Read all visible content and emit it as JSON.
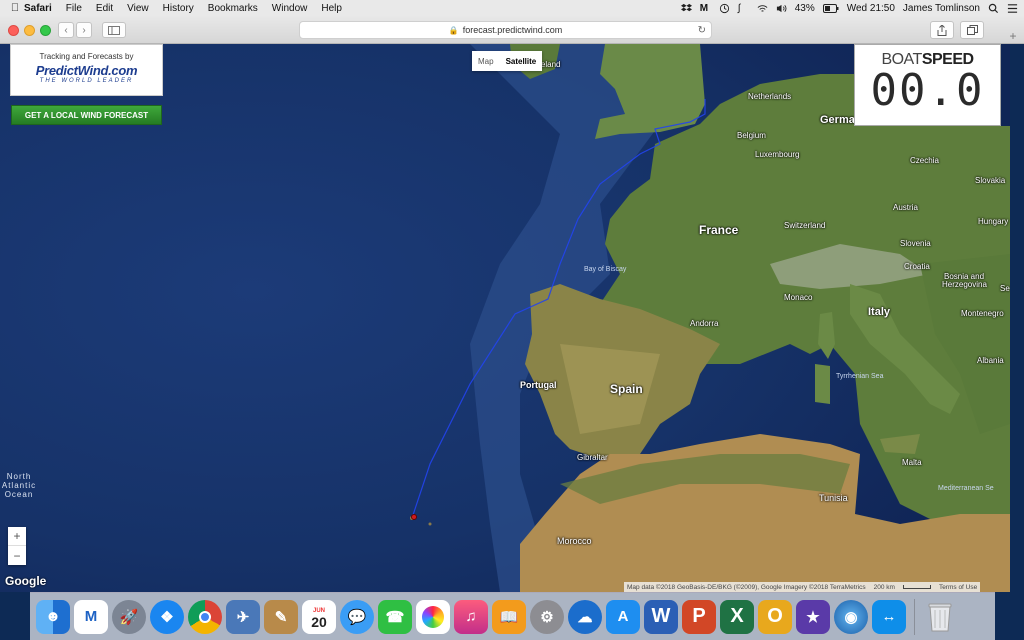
{
  "menubar": {
    "app": "Safari",
    "items": [
      "File",
      "Edit",
      "View",
      "History",
      "Bookmarks",
      "Window",
      "Help"
    ],
    "battery": "43%",
    "clock": "Wed 21:50",
    "user": "James Tomlinson"
  },
  "browser": {
    "url": "forecast.predictwind.com"
  },
  "page": {
    "logo_tagline": "Tracking and Forecasts by",
    "logo_brand": "PredictWind.com",
    "logo_slogan": "THE WORLD LEADER",
    "forecast_button": "GET A LOCAL WIND FORECAST",
    "maptype_map": "Map",
    "maptype_satellite": "Satellite",
    "boatspeed_prefix": "BOAT",
    "boatspeed_suffix": "SPEED",
    "boatspeed_value": "00.0",
    "zoom_in": "+",
    "zoom_out": "−",
    "google": "Google",
    "attribution": "Map data ©2018 GeoBasis-DE/BKG (©2009), Google Imagery ©2018 TerraMetrics",
    "scale": "200 km",
    "terms": "Terms of Use"
  },
  "map_labels": {
    "ireland": "Ireland",
    "netherlands": "Netherlands",
    "belgium": "Belgium",
    "luxembourg": "Luxembourg",
    "germany": "Germa",
    "czechia": "Czechia",
    "slovakia": "Slovakia",
    "austria": "Austria",
    "hungary": "Hungary",
    "france": "France",
    "switzerland": "Switzerland",
    "slovenia": "Slovenia",
    "croatia": "Croatia",
    "bosnia": "Bosnia and",
    "herzegovina": "Herzegovina",
    "serbia": "Se",
    "bay_biscay": "Bay of Biscay",
    "monaco": "Monaco",
    "andorra": "Andorra",
    "italy": "Italy",
    "montenegro": "Montenegro",
    "portugal": "Portugal",
    "spain": "Spain",
    "tyrrhenian": "Tyrrhenian Sea",
    "albania": "Albania",
    "gibraltar": "Gibraltar",
    "malta": "Malta",
    "mediterranean": "Mediterranean Se",
    "tunisia": "Tunisia",
    "morocco": "Morocco",
    "ocean_line1": "North",
    "ocean_line2": "Atlantic",
    "ocean_line3": "Ocean"
  },
  "dock": {
    "word": "W",
    "powerpoint": "P",
    "excel": "X",
    "outlook": "O",
    "calendar_month": "JUN",
    "calendar_day": "20"
  },
  "colors": {
    "ocean": "#1f3f80",
    "land": "#5d7a3a",
    "track": "#2244ee",
    "button_green": "#2f8f2c"
  }
}
